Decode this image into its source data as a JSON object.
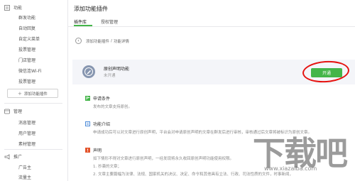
{
  "sidebar": {
    "group_function": "功能",
    "function_items": [
      "群发功能",
      "自动回复",
      "自定义菜单",
      "投票管理",
      "门店管理",
      "微信连Wi-Fi",
      "投票管理"
    ],
    "add_plugin_plus": "+",
    "add_plugin_label": "添加功能插件",
    "group_manage": "管理",
    "manage_items": [
      "消息管理",
      "用户管理",
      "素材管理"
    ],
    "group_promote": "推广",
    "promote_items": [
      "广告主",
      "流量主"
    ]
  },
  "main": {
    "title": "添加功能插件",
    "tabs": [
      {
        "label": "插件库",
        "active": true
      },
      {
        "label": "授权管理",
        "active": false
      }
    ]
  },
  "breadcrumb": {
    "back_glyph": "‹",
    "parent": "添加功能插件",
    "separator": "/",
    "current": "功能详情"
  },
  "plugin": {
    "name": "原创声明功能",
    "status": "未开通",
    "open_button": "开通"
  },
  "sections": [
    {
      "title": "申请条件",
      "lines": [
        "发布的文章支持原创。"
      ]
    },
    {
      "title": "功能介绍",
      "lines": [
        "申请成功后可以对文章进行原创声明，平台会对申请原创声明的文章在群发后进行审核，审核通过后文章将被标识为原创文章。"
      ]
    },
    {
      "title": "声明",
      "lines": [
        "如下情形不得对文章进行原创声明，一经发现将永久收回原创声明功能使用权限。",
        "1. 抄袭的文章；",
        "2. 文章主要篇幅为法律、法规、国家机关的决议、决定、命令和其他具有立法、行政、司法性质的文件，时事新闻，"
      ]
    }
  ],
  "watermark": {
    "big_text": "下载吧",
    "url": "www.xiazaiba.com"
  },
  "colors": {
    "accent_green": "#44b549",
    "annotation_red": "#e6120f",
    "plugin_icon_bg": "#8796b0",
    "card_bg": "#f4f5f9",
    "divider": "#e7e7eb"
  }
}
